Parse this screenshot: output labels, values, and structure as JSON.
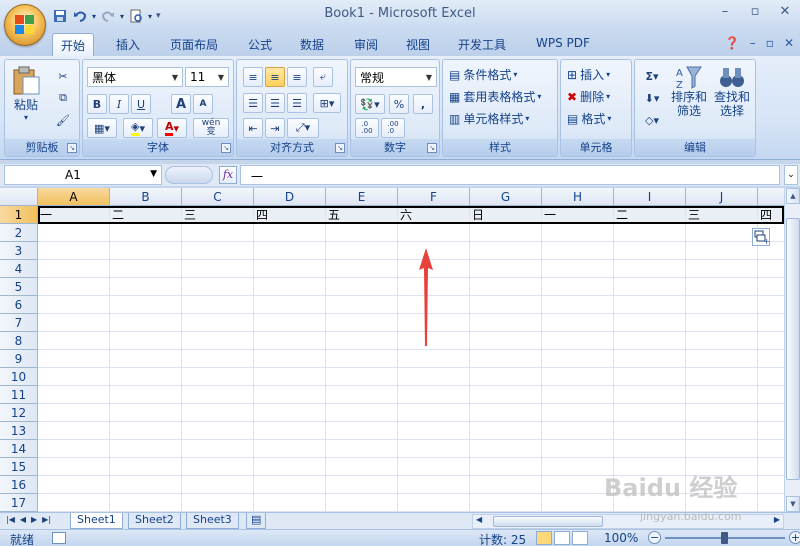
{
  "window": {
    "title": "Book1 - Microsoft Excel"
  },
  "qat": {
    "save_icon": "save-icon",
    "undo_icon": "undo-icon",
    "redo_icon": "redo-icon",
    "preview_icon": "print-preview-icon"
  },
  "tabs": [
    {
      "label": "开始"
    },
    {
      "label": "插入"
    },
    {
      "label": "页面布局"
    },
    {
      "label": "公式"
    },
    {
      "label": "数据"
    },
    {
      "label": "审阅"
    },
    {
      "label": "视图"
    },
    {
      "label": "开发工具"
    },
    {
      "label": "WPS PDF"
    }
  ],
  "ribbon": {
    "clipboard": {
      "label": "剪贴板",
      "paste": "粘贴"
    },
    "font": {
      "label": "字体",
      "name": "黑体",
      "size": "11",
      "bold": "B",
      "italic": "I",
      "underline": "U",
      "grow": "A",
      "shrink": "A",
      "wen": "wén\n变"
    },
    "align": {
      "label": "对齐方式"
    },
    "number": {
      "label": "数字",
      "format": "常规",
      "percent": "%",
      "comma": ",",
      "inc": ".0\n.00",
      "dec": ".00\n.0"
    },
    "styles": {
      "label": "样式",
      "cond": "条件格式",
      "table": "套用表格格式",
      "cell": "单元格样式"
    },
    "cells": {
      "label": "单元格",
      "insert": "插入",
      "delete": "删除",
      "format": "格式"
    },
    "edit": {
      "label": "编辑",
      "sort": "排序和\n筛选",
      "find": "查找和\n选择"
    }
  },
  "formula_bar": {
    "name_box": "A1",
    "fx": "fx",
    "content": "一"
  },
  "grid": {
    "columns": [
      "A",
      "B",
      "C",
      "D",
      "E",
      "F",
      "G",
      "H",
      "I",
      "J"
    ],
    "rows": [
      "1",
      "2",
      "3",
      "4",
      "5",
      "6",
      "7",
      "8",
      "9",
      "10",
      "11",
      "12",
      "13",
      "14",
      "15",
      "16",
      "17"
    ],
    "row1": [
      "一",
      "二",
      "三",
      "四",
      "五",
      "六",
      "日",
      "一",
      "二",
      "三",
      "四"
    ]
  },
  "sheets": [
    {
      "label": "Sheet1"
    },
    {
      "label": "Sheet2"
    },
    {
      "label": "Sheet3"
    }
  ],
  "status": {
    "ready": "就绪",
    "count": "计数: 25",
    "zoom": "100%"
  },
  "watermark": {
    "line1": "Baidu 经验",
    "line2": "jingyan.baidu.com"
  },
  "colors": {
    "accent": "#15428b",
    "selected_header": "#f1c15f",
    "arrow": "#e8403a"
  }
}
